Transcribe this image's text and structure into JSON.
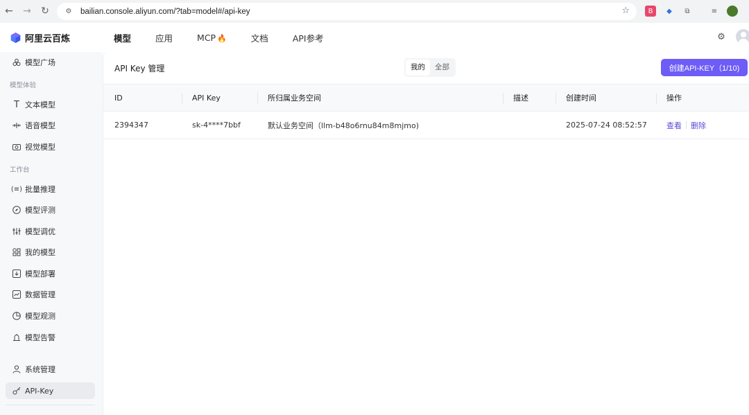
{
  "browser": {
    "url": "bailian.console.aliyun.com/?tab=model#/api-key"
  },
  "brand": {
    "name": "阿里云百炼",
    "accent": "#6d5cf6"
  },
  "topnav": {
    "tabs": [
      {
        "label": "模型",
        "active": true
      },
      {
        "label": "应用",
        "active": false
      },
      {
        "label": "MCP",
        "active": false
      },
      {
        "label": "文档",
        "active": false
      },
      {
        "label": "API参考",
        "active": false
      }
    ]
  },
  "sidebar": {
    "items_top": [
      {
        "label": "模型广场",
        "icon": "model-square-icon"
      }
    ],
    "section_experience": "模型体验",
    "experience_items": [
      {
        "label": "文本模型",
        "icon": "text-icon"
      },
      {
        "label": "语音模型",
        "icon": "audio-icon"
      },
      {
        "label": "视觉模型",
        "icon": "camera-icon"
      }
    ],
    "section_workbench": "工作台",
    "workbench_items": [
      {
        "label": "批量推理",
        "icon": "batch-icon"
      },
      {
        "label": "模型评测",
        "icon": "compass-icon"
      },
      {
        "label": "模型调优",
        "icon": "tune-icon"
      },
      {
        "label": "我的模型",
        "icon": "grid-icon"
      },
      {
        "label": "模型部署",
        "icon": "deploy-icon"
      },
      {
        "label": "数据管理",
        "icon": "chart-icon"
      },
      {
        "label": "模型观测",
        "icon": "pie-icon"
      },
      {
        "label": "模型告警",
        "icon": "alarm-icon"
      }
    ],
    "bottom_items": [
      {
        "label": "系统管理",
        "icon": "user-icon"
      },
      {
        "label": "API-Key",
        "icon": "key-icon",
        "active": true
      }
    ]
  },
  "main": {
    "title": "API Key 管理",
    "segment": [
      "我的",
      "全部"
    ],
    "segment_active": 0,
    "create_button": "创建API-KEY（1/10)",
    "columns": [
      "ID",
      "API Key",
      "所归属业务空间",
      "描述",
      "创建时间",
      "操作"
    ],
    "rows": [
      {
        "id": "2394347",
        "api_key": "sk-4****7bbf",
        "workspace": "默认业务空间（llm-b48o6rnu84m8mjmo)",
        "description": "",
        "created": "2025-07-24 08:52:57",
        "actions": [
          "查看",
          "删除"
        ]
      }
    ]
  }
}
